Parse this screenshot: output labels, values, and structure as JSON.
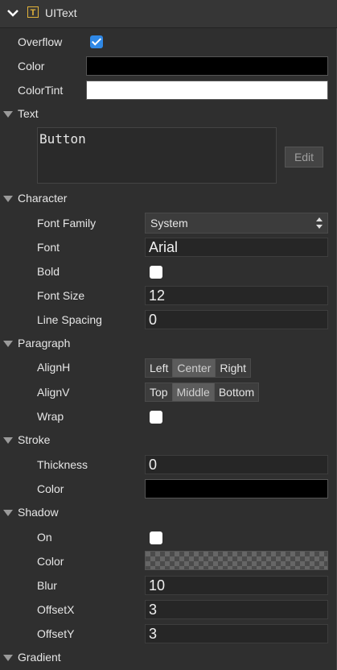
{
  "component": {
    "title": "UIText",
    "icon_letter": "T"
  },
  "fields": {
    "overflow": {
      "label": "Overflow",
      "checked": true
    },
    "color": {
      "label": "Color",
      "value": "#000000"
    },
    "color_tint": {
      "label": "ColorTint",
      "value": "#ffffff"
    }
  },
  "text_section": {
    "title": "Text",
    "value": "Button",
    "edit_label": "Edit"
  },
  "character": {
    "title": "Character",
    "font_family_label": "Font Family",
    "font_family_value": "System",
    "font_label": "Font",
    "font_value": "Arial",
    "bold_label": "Bold",
    "bold_checked": false,
    "font_size_label": "Font Size",
    "font_size_value": "12",
    "line_spacing_label": "Line Spacing",
    "line_spacing_value": "0"
  },
  "paragraph": {
    "title": "Paragraph",
    "align_h_label": "AlignH",
    "align_h_options": [
      "Left",
      "Center",
      "Right"
    ],
    "align_h_selected": "Center",
    "align_v_label": "AlignV",
    "align_v_options": [
      "Top",
      "Middle",
      "Bottom"
    ],
    "align_v_selected": "Middle",
    "wrap_label": "Wrap",
    "wrap_checked": false
  },
  "stroke": {
    "title": "Stroke",
    "thickness_label": "Thickness",
    "thickness_value": "0",
    "color_label": "Color",
    "color_value": "#000000"
  },
  "shadow": {
    "title": "Shadow",
    "on_label": "On",
    "on_checked": false,
    "color_label": "Color",
    "blur_label": "Blur",
    "blur_value": "10",
    "offset_x_label": "OffsetX",
    "offset_x_value": "3",
    "offset_y_label": "OffsetY",
    "offset_y_value": "3"
  },
  "gradient": {
    "title": "Gradient"
  }
}
